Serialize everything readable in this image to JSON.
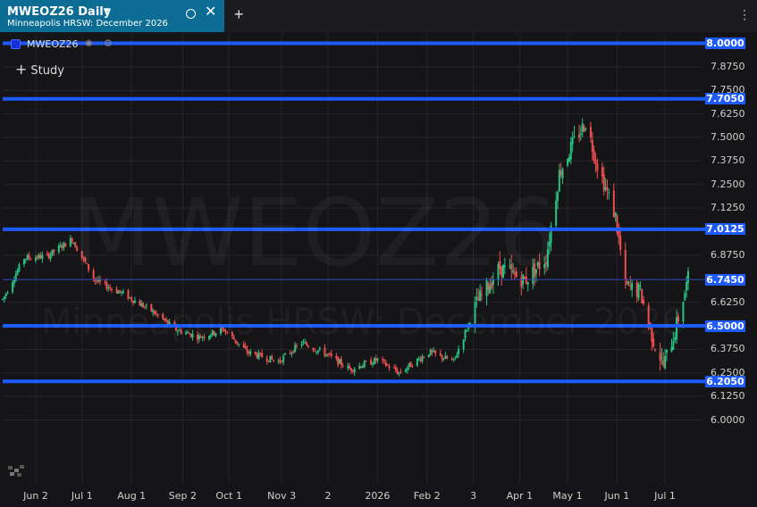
{
  "tab": {
    "title": "MWEOZ26 Daily",
    "subtitle": "Minneapolis HRSW: December 2026"
  },
  "legend": {
    "symbol": "MWEOZ26"
  },
  "study_label": "Study",
  "watermark": {
    "symbol": "MWEOZ26",
    "name": "Minneapolis HRSW: December 2026"
  },
  "colors": {
    "up": "#26c281",
    "down": "#ef4f4f",
    "hline": "#1e5bff",
    "background": "#151518"
  },
  "icons": [
    "caret-down-icon",
    "ring-icon",
    "close-icon",
    "plus-icon",
    "menu-dots-icon",
    "eye-icon",
    "gear-icon",
    "logo-icon"
  ],
  "chart_data": {
    "type": "candlestick",
    "title": "MWEOZ26 Daily",
    "ylim": [
      5.95,
      8.04
    ],
    "yticks": [
      "8.0000",
      "7.8750",
      "7.7500",
      "7.7050",
      "7.6250",
      "7.5000",
      "7.3750",
      "7.2500",
      "7.1250",
      "7.0125",
      "6.8750",
      "6.7450",
      "6.6250",
      "6.5000",
      "6.3750",
      "6.2500",
      "6.2050",
      "6.1250",
      "6.0000"
    ],
    "xticks": [
      "Jun 2",
      "Jul 1",
      "Aug 1",
      "Sep 2",
      "Oct 1",
      "Nov 3",
      "2",
      "2026",
      "Feb 2",
      "3",
      "Apr 1",
      "May 1",
      "Jun 1",
      "Jul 1"
    ],
    "horizontal_lines": [
      {
        "label": "8.0000",
        "value": 8.0
      },
      {
        "label": "7.7050",
        "value": 7.705
      },
      {
        "label": "7.0125",
        "value": 7.0125
      },
      {
        "label": "6.5000",
        "value": 6.5
      },
      {
        "label": "6.2050",
        "value": 6.205
      }
    ],
    "last_price": {
      "label": "6.7450",
      "value": 6.745
    },
    "series": [
      {
        "date": "2025-05-20",
        "value": 6.64
      },
      {
        "date": "2025-06-02",
        "value": 6.86
      },
      {
        "date": "2025-06-16",
        "value": 6.87
      },
      {
        "date": "2025-07-01",
        "value": 6.96
      },
      {
        "date": "2025-07-15",
        "value": 6.74
      },
      {
        "date": "2025-08-01",
        "value": 6.67
      },
      {
        "date": "2025-08-18",
        "value": 6.58
      },
      {
        "date": "2025-09-02",
        "value": 6.48
      },
      {
        "date": "2025-09-16",
        "value": 6.44
      },
      {
        "date": "2025-10-01",
        "value": 6.48
      },
      {
        "date": "2025-10-15",
        "value": 6.36
      },
      {
        "date": "2025-11-03",
        "value": 6.31
      },
      {
        "date": "2025-11-17",
        "value": 6.41
      },
      {
        "date": "2025-12-02",
        "value": 6.35
      },
      {
        "date": "2025-12-16",
        "value": 6.27
      },
      {
        "date": "2026-01-02",
        "value": 6.32
      },
      {
        "date": "2026-01-15",
        "value": 6.25
      },
      {
        "date": "2026-02-02",
        "value": 6.36
      },
      {
        "date": "2026-02-17",
        "value": 6.31
      },
      {
        "date": "2026-03-03",
        "value": 6.62
      },
      {
        "date": "2026-03-17",
        "value": 6.81
      },
      {
        "date": "2026-04-01",
        "value": 6.74
      },
      {
        "date": "2026-04-14",
        "value": 6.86
      },
      {
        "date": "2026-04-22",
        "value": 7.31
      },
      {
        "date": "2026-05-01",
        "value": 7.48
      },
      {
        "date": "2026-05-08",
        "value": 7.58
      },
      {
        "date": "2026-05-15",
        "value": 7.36
      },
      {
        "date": "2026-05-26",
        "value": 7.08
      },
      {
        "date": "2026-06-01",
        "value": 6.71
      },
      {
        "date": "2026-06-10",
        "value": 6.68
      },
      {
        "date": "2026-06-18",
        "value": 6.42
      },
      {
        "date": "2026-06-24",
        "value": 6.29
      },
      {
        "date": "2026-07-01",
        "value": 6.47
      },
      {
        "date": "2026-07-09",
        "value": 6.75
      }
    ]
  }
}
